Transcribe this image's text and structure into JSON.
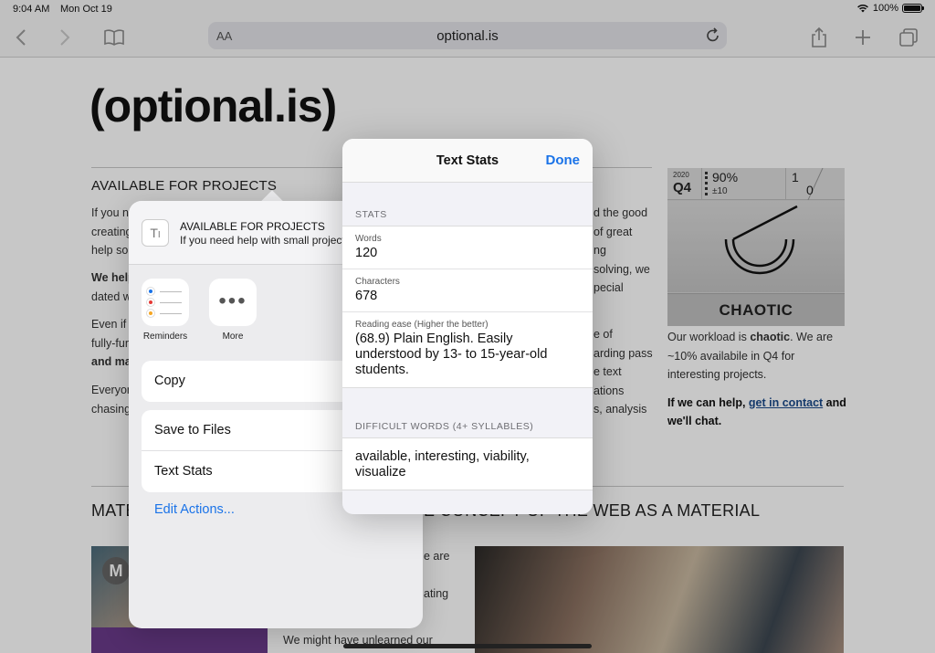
{
  "status": {
    "time": "9:04 AM",
    "date": "Mon Oct 19",
    "battery": "100%",
    "battery_level": 1.0
  },
  "toolbar": {
    "aa": "AA",
    "url": "optional.is"
  },
  "page": {
    "logo": "(optional.is)",
    "available_title": "AVAILABLE FOR PROJECTS",
    "para1": [
      "If you ne",
      "creating",
      "help sol"
    ],
    "para2": [
      "We help",
      "dated w"
    ],
    "para3": [
      "Even if y",
      "fully-fun",
      "and ma"
    ],
    "para4": [
      "Everyon",
      "chasing"
    ],
    "right_col": [
      "d the good",
      "of great",
      "ng",
      "solving, we",
      "pecial",
      "e of",
      "arding pass",
      "e text",
      "ations",
      "s, analysis"
    ],
    "badge": {
      "year": "2020",
      "quarter": "Q4",
      "percent": "90%",
      "plusminus": "±10",
      "n1": "1",
      "n0": "0",
      "label": "CHAOTIC"
    },
    "badge_text_1": "Our workload is ",
    "badge_text_bold": "chaotic",
    "badge_text_2": ". We are ~10% availabile in Q4 for interesting projects.",
    "help_bold_1": "If we can help, ",
    "help_link": "get in contact",
    "help_bold_2": " and we'll chat.",
    "material_title": "MATE",
    "web_material": "E CONCEPT OF THE WEB AS A MATERIAL",
    "mid_lines": [
      "e are",
      "ating"
    ],
    "bottom_line": "We might have unlearned our"
  },
  "share": {
    "title": "AVAILABLE FOR PROJECTS",
    "subtitle": "If you need help with small projects",
    "apps": [
      {
        "name": "Reminders"
      },
      {
        "name": "More"
      }
    ],
    "actions_1": [
      "Copy"
    ],
    "actions_2": [
      "Save to Files",
      "Text Stats"
    ],
    "edit_actions": "Edit Actions..."
  },
  "text_stats": {
    "title": "Text Stats",
    "done": "Done",
    "stats_label": "STATS",
    "words_label": "Words",
    "words": "120",
    "characters_label": "Characters",
    "characters": "678",
    "reading_label": "Reading ease (Higher the better)",
    "reading_value": "(68.9) Plain English. Easily understood by 13- to 15-year-old students.",
    "difficult_label": "DIFFICULT WORDS (4+ SYLLABLES)",
    "difficult_words": "available, interesting, viability, visualize"
  },
  "colors": {
    "accent": "#1a73e8",
    "link": "#1a4a8a"
  }
}
